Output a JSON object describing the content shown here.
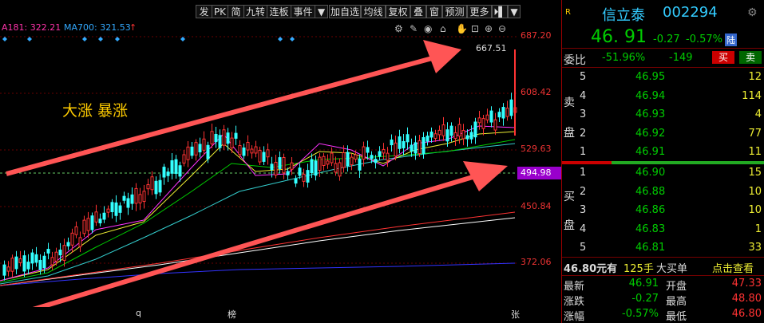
{
  "toolbar": {
    "buttons": [
      "发",
      "PK",
      "简",
      "九转",
      "连板",
      "事件",
      "▼",
      "加自选",
      "均线",
      "复权",
      "叠",
      "窗",
      "预测",
      "更多",
      "⏵▌",
      "▼"
    ]
  },
  "ma": {
    "ma181": "A181: 322.21",
    "ma700": "MA700: 321.53",
    "arrow": "↑"
  },
  "price_axis": {
    "labels": [
      "687.20",
      "608.42",
      "529.63",
      "494.98",
      "450.84",
      "372.06"
    ],
    "high_label": "667.51"
  },
  "annotation": "大涨 暴涨",
  "date_marks": [
    "q",
    "榜",
    "张"
  ],
  "panel": {
    "r_badge": "R",
    "stock_name": "信立泰",
    "stock_code": "002294",
    "gear": "⚙",
    "price": "46. 91",
    "change": "-0.27",
    "pct": "-0.57%",
    "lu_badge": "陆",
    "weibi_label": "委比",
    "weibi_value": "-51.96%",
    "weicha": "-149",
    "buy_btn": "买",
    "sell_btn": "卖",
    "sell_side_label": [
      "卖",
      "盘"
    ],
    "buy_side_label": [
      "买",
      "盘"
    ],
    "asks": [
      {
        "level": "5",
        "price": "46.95",
        "vol": "12"
      },
      {
        "level": "4",
        "price": "46.94",
        "vol": "114"
      },
      {
        "level": "3",
        "price": "46.93",
        "vol": "4"
      },
      {
        "level": "2",
        "price": "46.92",
        "vol": "77"
      },
      {
        "level": "1",
        "price": "46.91",
        "vol": "11"
      }
    ],
    "bids": [
      {
        "level": "1",
        "price": "46.90",
        "vol": "15"
      },
      {
        "level": "2",
        "price": "46.88",
        "vol": "10"
      },
      {
        "level": "3",
        "price": "46.86",
        "vol": "10"
      },
      {
        "level": "4",
        "price": "46.83",
        "vol": "1"
      },
      {
        "level": "5",
        "price": "46.81",
        "vol": "33"
      }
    ],
    "bigbuy": {
      "amount": "46.80元有",
      "hands": "125手",
      "label": "大买单",
      "link": "点击查看"
    },
    "stats": [
      {
        "l1": "最新",
        "v1": "46.91",
        "l2": "开盘",
        "v2": "47.33"
      },
      {
        "l1": "涨跌",
        "v1": "-0.27",
        "l2": "最高",
        "v2": "48.80"
      },
      {
        "l1": "涨幅",
        "v1": "-0.57%",
        "l2": "最低",
        "v2": "46.80"
      }
    ]
  },
  "colors": {
    "up": "#ff3333",
    "down": "#33ffff",
    "bg": "#000000",
    "accent": "#ffcc00"
  }
}
